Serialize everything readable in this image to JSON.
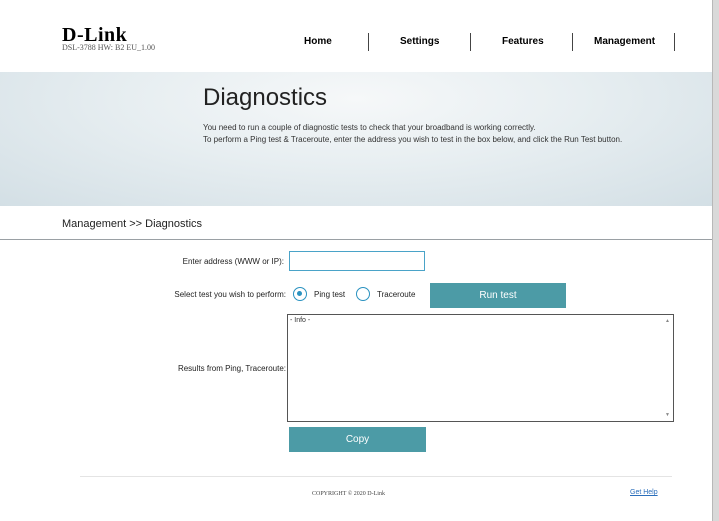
{
  "brand": {
    "logo": "D-Link",
    "model": "DSL-3788  HW: B2  EU_1.00"
  },
  "nav": {
    "home": "Home",
    "settings": "Settings",
    "features": "Features",
    "management": "Management"
  },
  "banner": {
    "title": "Diagnostics",
    "line1": "You need to run a couple of diagnostic tests to check that your broadband is working correctly.",
    "line2": "To perform a Ping test & Traceroute, enter the address you wish to test in the box below, and click the Run Test button."
  },
  "breadcrumb": "Management >> Diagnostics",
  "form": {
    "address_label": "Enter address (WWW or IP):",
    "address_value": "",
    "test_label": "Select test you wish to perform:",
    "ping_label": "Ping test",
    "traceroute_label": "Traceroute",
    "selected_test": "Ping test",
    "run_button": "Run test",
    "results_label": "Results from Ping, Traceroute:",
    "results_text": "- Info -",
    "copy_button": "Copy"
  },
  "footer": {
    "copyright": "COPYRIGHT © 2020 D-Link",
    "help": "Get Help"
  },
  "colors": {
    "accent": "#4c9ba6",
    "radio": "#2a92c0",
    "link": "#2a6ebb"
  }
}
